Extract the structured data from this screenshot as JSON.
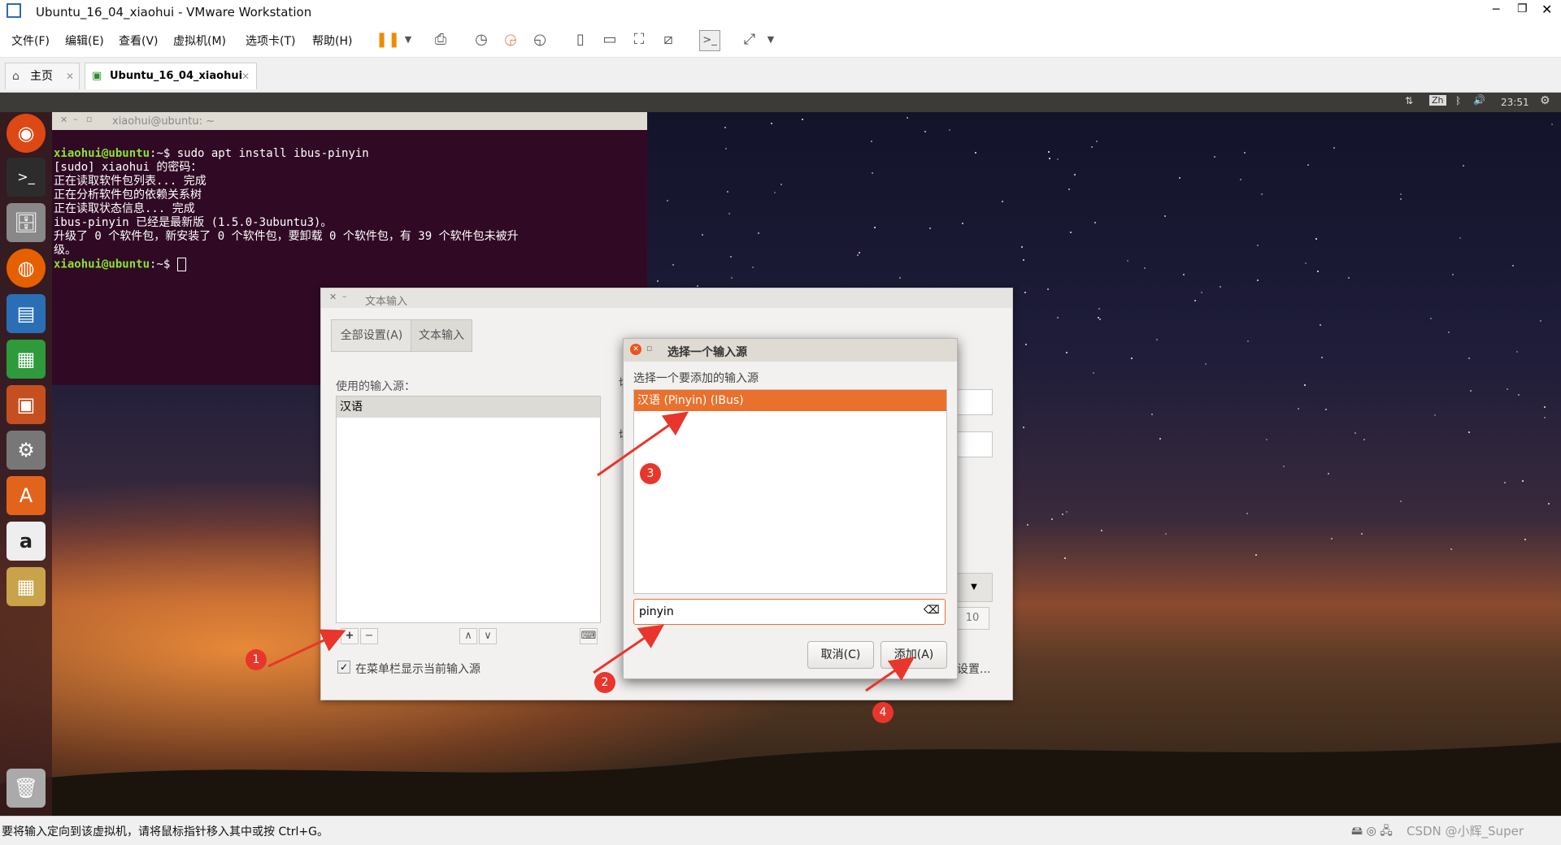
{
  "window": {
    "title": "Ubuntu_16_04_xiaohui - VMware Workstation"
  },
  "menu": [
    "文件(F)",
    "编辑(E)",
    "查看(V)",
    "虚拟机(M)",
    "选项卡(T)",
    "帮助(H)"
  ],
  "tabs": [
    {
      "label": "主页",
      "active": false
    },
    {
      "label": "Ubuntu_16_04_xiaohui",
      "active": true
    }
  ],
  "ubuntu_panel": {
    "lang": "Zh",
    "time": "23:51"
  },
  "terminal": {
    "title": "xiaohui@ubuntu: ~",
    "lines": [
      {
        "prompt": "xiaohui@ubuntu",
        "rest": ":~$ sudo apt install ibus-pinyin"
      },
      {
        "text": "[sudo] xiaohui 的密码："
      },
      {
        "text": "正在读取软件包列表... 完成"
      },
      {
        "text": "正在分析软件包的依赖关系树"
      },
      {
        "text": "正在读取状态信息... 完成"
      },
      {
        "text": "ibus-pinyin 已经是最新版 (1.5.0-3ubuntu3)。"
      },
      {
        "text": "升级了 0 个软件包，新安装了 0 个软件包，要卸载 0 个软件包，有 39 个软件包未被升"
      },
      {
        "text": "级。"
      },
      {
        "prompt": "xiaohui@ubuntu",
        "rest": ":~$ "
      }
    ]
  },
  "text_input": {
    "title": "文本输入",
    "tabs": [
      "全部设置(A)",
      "文本输入"
    ],
    "sources_label": "使用的输入源：",
    "sources": [
      "汉语"
    ],
    "show_in_menu_label": "在菜单栏显示当前输入源",
    "right_partial": {
      "cut1": "切",
      "cut2": "切",
      "spin": "10",
      "settings": "设置..."
    }
  },
  "chooser": {
    "title": "选择一个输入源",
    "prompt": "选择一个要添加的输入源",
    "items": [
      "汉语 (Pinyin) (IBus)"
    ],
    "search_value": "pinyin",
    "cancel_label": "取消(C)",
    "add_label": "添加(A)"
  },
  "annotations": [
    "1",
    "2",
    "3",
    "4"
  ],
  "statusbar": {
    "text": "要将输入定向到该虚拟机，请将鼠标指针移入其中或按 Ctrl+G。",
    "watermark": "CSDN @小辉_Super"
  },
  "colors": {
    "selection": "#e9712d",
    "terminal_bg": "#300a24",
    "badge": "#e8362c"
  }
}
